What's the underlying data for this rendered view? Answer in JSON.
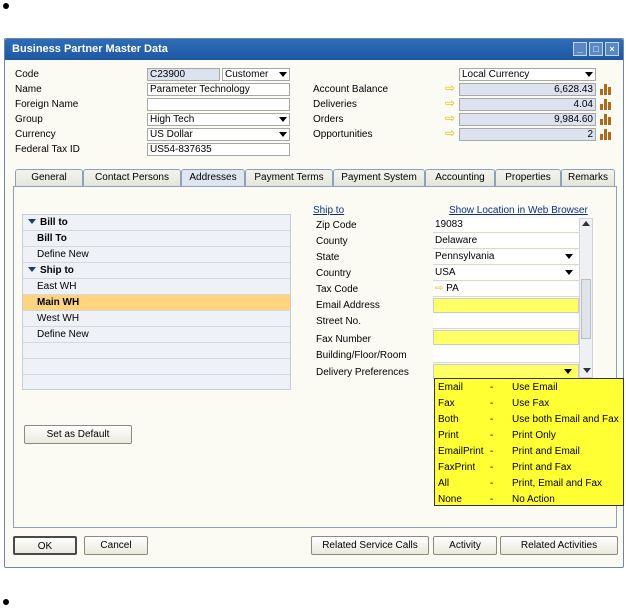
{
  "window": {
    "title": "Business Partner Master Data"
  },
  "header": {
    "code_label": "Code",
    "code_value": "C23900",
    "type_value": "Customer",
    "name_label": "Name",
    "name_value": "Parameter Technology",
    "foreign_name_label": "Foreign Name",
    "foreign_name_value": "",
    "group_label": "Group",
    "group_value": "High Tech",
    "currency_label": "Currency",
    "currency_value": "US Dollar",
    "tax_id_label": "Federal Tax ID",
    "tax_id_value": "US54-837635",
    "local_currency": "Local Currency",
    "account_balance_label": "Account Balance",
    "account_balance_value": "6,628.43",
    "deliveries_label": "Deliveries",
    "deliveries_value": "4.04",
    "orders_label": "Orders",
    "orders_value": "9,984.60",
    "opportunities_label": "Opportunities",
    "opportunities_value": "2"
  },
  "tabs": [
    "General",
    "Contact Persons",
    "Addresses",
    "Payment Terms",
    "Payment System",
    "Accounting",
    "Properties",
    "Remarks"
  ],
  "address_list": {
    "bill_to_group": "Bill to",
    "bill_to_item": "Bill To",
    "bill_define_new": "Define New",
    "ship_to_group": "Ship to",
    "ship_east": "East WH",
    "ship_main": "Main WH",
    "ship_west": "West WH",
    "ship_define_new": "Define New"
  },
  "set_default_label": "Set as Default",
  "details": {
    "ship_to_link": "Ship to",
    "show_location_link": "Show Location in Web Browser",
    "zip_label": "Zip Code",
    "zip_value": "19083",
    "county_label": "County",
    "county_value": "Delaware",
    "state_label": "State",
    "state_value": "Pennsylvania",
    "country_label": "Country",
    "country_value": "USA",
    "tax_code_label": "Tax Code",
    "tax_code_value": "PA",
    "email_label": "Email Address",
    "street_label": "Street No.",
    "fax_label": "Fax Number",
    "building_label": "Building/Floor/Room",
    "delivery_pref_label": "Delivery Preferences"
  },
  "delivery_options": [
    {
      "code": "Email",
      "dash": "-",
      "desc": "Use Email"
    },
    {
      "code": "Fax",
      "dash": "-",
      "desc": "Use Fax"
    },
    {
      "code": "Both",
      "dash": "-",
      "desc": "Use both Email and Fax"
    },
    {
      "code": "Print",
      "dash": "-",
      "desc": "Print Only"
    },
    {
      "code": "EmailPrint",
      "dash": "-",
      "desc": "Print and Email"
    },
    {
      "code": "FaxPrint",
      "dash": "-",
      "desc": "Print and Fax"
    },
    {
      "code": "All",
      "dash": "-",
      "desc": "Print, Email and Fax"
    },
    {
      "code": "None",
      "dash": "-",
      "desc": "No Action"
    }
  ],
  "footer": {
    "ok": "OK",
    "cancel": "Cancel",
    "related_service_calls": "Related Service Calls",
    "activity": "Activity",
    "related_activities": "Related Activities"
  },
  "colors": {
    "titlebar": "#1d57a3",
    "highlight": "#ffff66",
    "selected_row": "#ffd47f"
  }
}
